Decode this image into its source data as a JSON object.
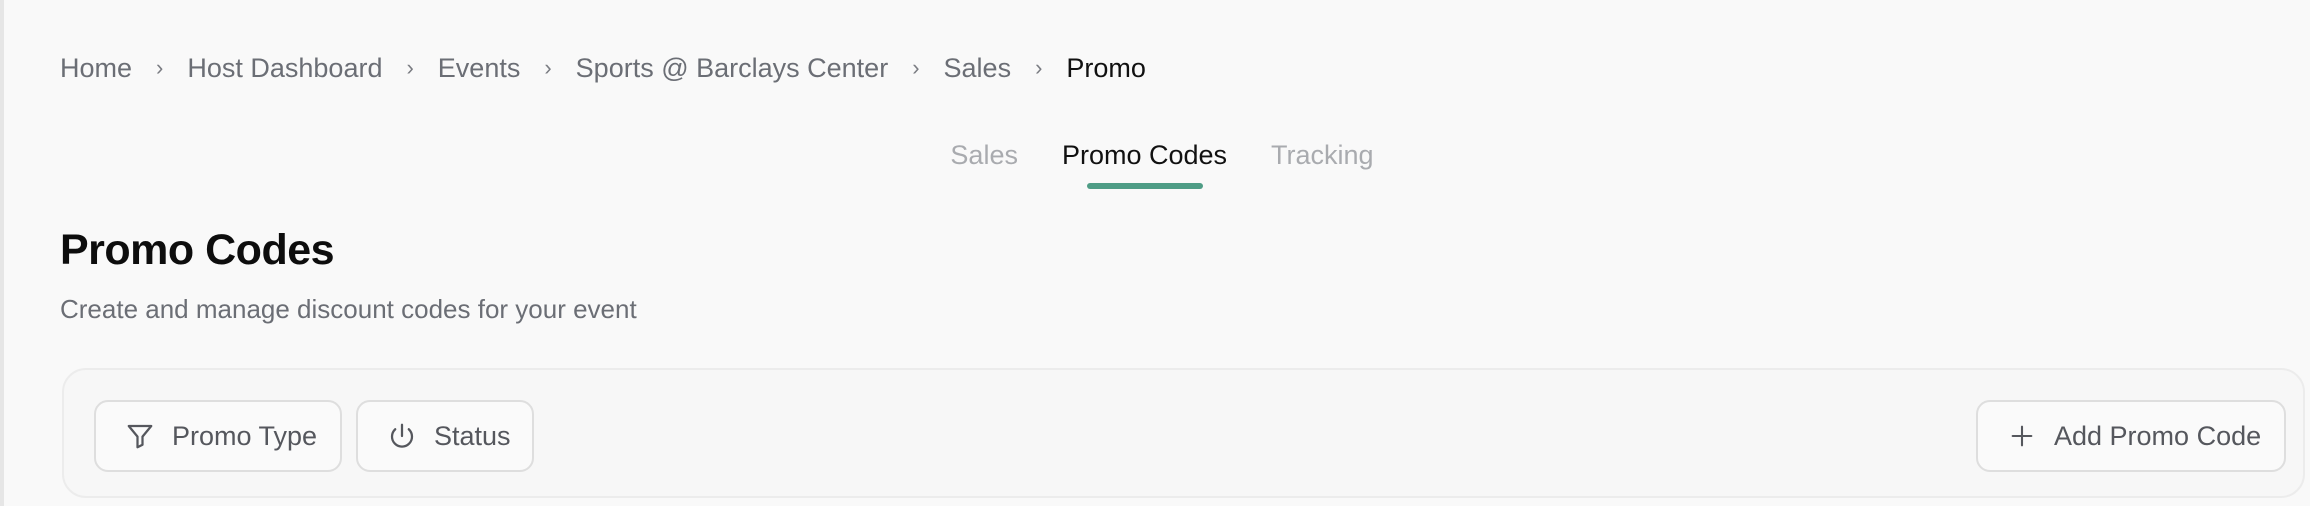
{
  "breadcrumb": {
    "items": [
      {
        "label": "Home"
      },
      {
        "label": "Host Dashboard"
      },
      {
        "label": "Events"
      },
      {
        "label": "Sports @ Barclays Center"
      },
      {
        "label": "Sales"
      },
      {
        "label": "Promo"
      }
    ],
    "separator": "›"
  },
  "tabs": [
    {
      "label": "Sales",
      "active": false
    },
    {
      "label": "Promo Codes",
      "active": true
    },
    {
      "label": "Tracking",
      "active": false
    }
  ],
  "header": {
    "title": "Promo Codes",
    "subtitle": "Create and manage discount codes for your event"
  },
  "toolbar": {
    "promo_type_label": "Promo Type",
    "promo_type_icon": "filter-icon",
    "status_label": "Status",
    "status_icon": "power-icon",
    "add_label": "Add Promo Code",
    "add_icon": "plus-icon"
  },
  "colors": {
    "accent": "#4f9d86",
    "background": "#f9f9f9",
    "muted_text": "#6b6e75",
    "inactive_tab": "#a9abaf"
  }
}
